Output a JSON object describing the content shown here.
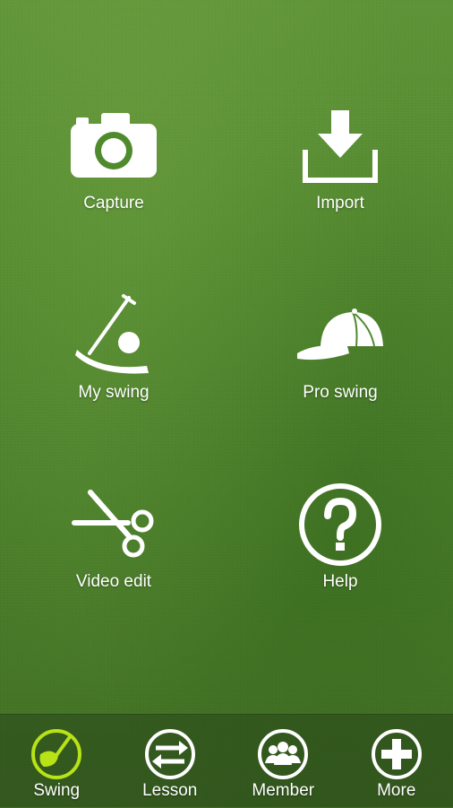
{
  "menu": {
    "capture": {
      "label": "Capture",
      "icon": "camera-icon"
    },
    "import": {
      "label": "Import",
      "icon": "download-icon"
    },
    "my_swing": {
      "label": "My swing",
      "icon": "golf-club-ball-icon"
    },
    "pro_swing": {
      "label": "Pro swing",
      "icon": "cap-icon"
    },
    "video_edit": {
      "label": "Video edit",
      "icon": "scissors-icon"
    },
    "help": {
      "label": "Help",
      "icon": "question-circle-icon"
    }
  },
  "tabbar": {
    "active": "swing",
    "accent_color": "#b7e317",
    "tabs": [
      {
        "id": "swing",
        "label": "Swing",
        "icon": "golf-club-head-icon"
      },
      {
        "id": "lesson",
        "label": "Lesson",
        "icon": "arrows-swap-icon"
      },
      {
        "id": "member",
        "label": "Member",
        "icon": "group-icon"
      },
      {
        "id": "more",
        "label": "More",
        "icon": "plus-icon"
      }
    ]
  }
}
